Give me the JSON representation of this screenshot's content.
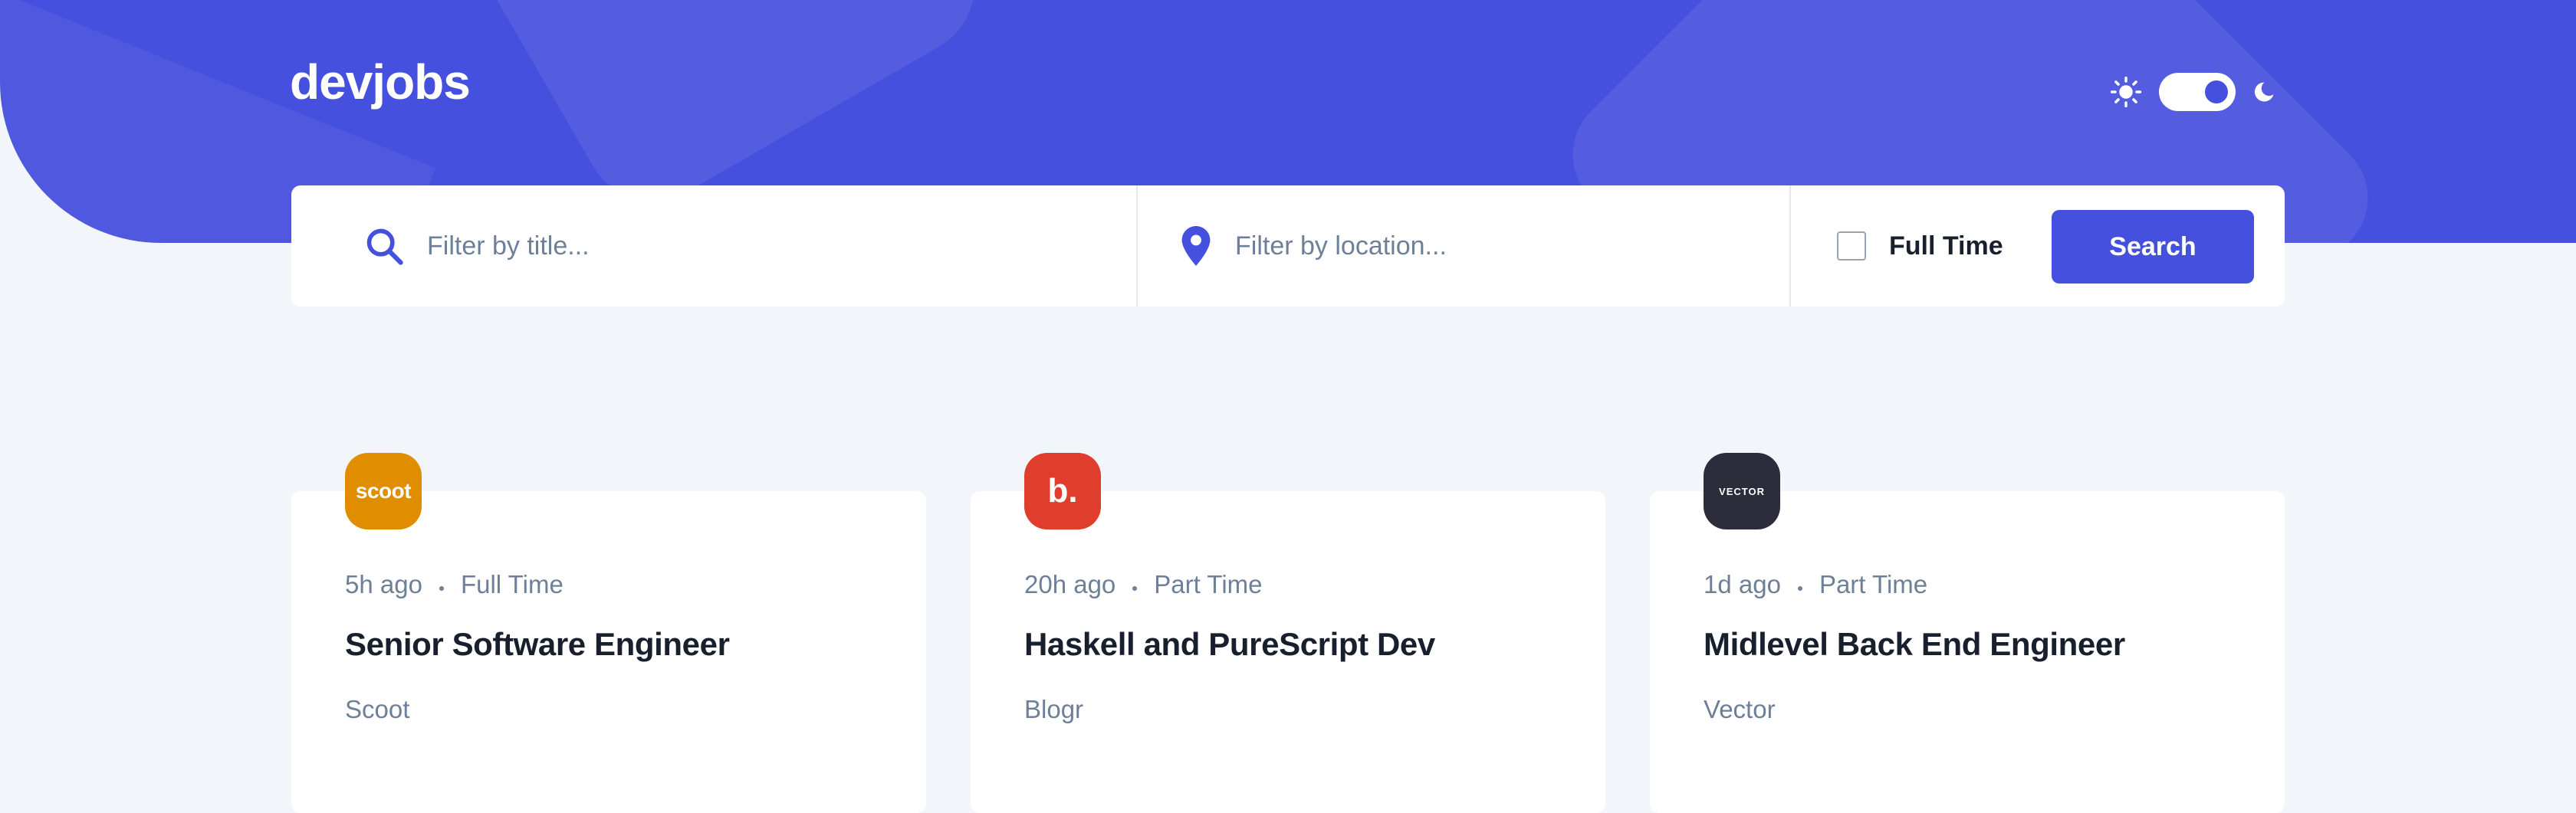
{
  "header": {
    "logo": "devjobs",
    "theme_toggle": {
      "mode": "dark",
      "light_icon": "sun-icon",
      "dark_icon": "moon-icon"
    }
  },
  "search": {
    "title_placeholder": "Filter by title...",
    "location_placeholder": "Filter by location...",
    "fulltime_label": "Full Time",
    "fulltime_checked": false,
    "button_label": "Search"
  },
  "jobs": [
    {
      "posted": "5h ago",
      "contract": "Full Time",
      "position": "Senior Software Engineer",
      "company": "Scoot",
      "logo_text": "scoot",
      "logo_color": "#E08D00"
    },
    {
      "posted": "20h ago",
      "contract": "Part Time",
      "position": "Haskell and PureScript Dev",
      "company": "Blogr",
      "logo_text": "b.",
      "logo_color": "#E03E2D"
    },
    {
      "posted": "1d ago",
      "contract": "Part Time",
      "position": "Midlevel Back End Engineer",
      "company": "Vector",
      "logo_text": "VECTOR",
      "logo_color": "#2C2C3A"
    }
  ],
  "colors": {
    "brand": "#4650DE",
    "background": "#F2F5F9",
    "text_dark": "#19202D",
    "text_gray": "#6E8098"
  }
}
